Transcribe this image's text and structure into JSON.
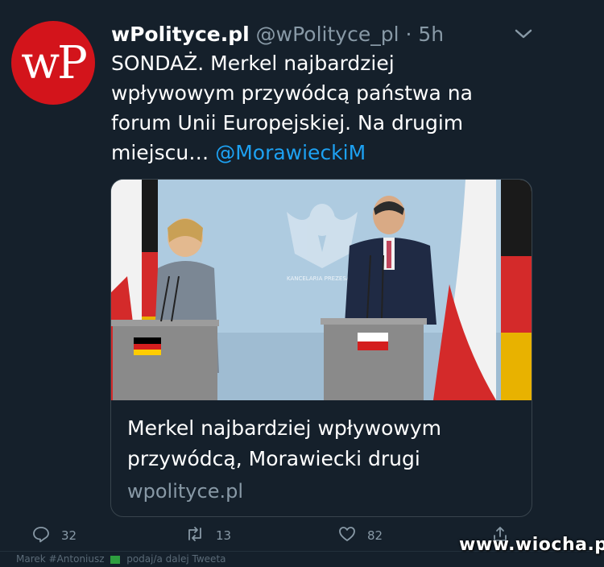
{
  "tweet": {
    "avatar_text": "wP",
    "display_name": "wPolityce.pl",
    "handle": "@wPolityce_pl",
    "separator": "·",
    "time": "5h",
    "text_line1": "SONDAŻ. Merkel najbardziej",
    "text_line2": "wpływowym przywódcą państwa na",
    "text_line3": "forum Unii Europejskiej. Na drugim",
    "text_line4_prefix": "miejscu…",
    "mention": "@MorawieckiM"
  },
  "card": {
    "title_line1": "Merkel najbardziej wpływowym",
    "title_line2": "przywódcą, Morawiecki drugi",
    "domain": "wpolityce.pl",
    "image_backdrop_text": "KANCELARIA PREZESA RADY MINISTRÓW"
  },
  "actions": {
    "reply_count": "32",
    "retweet_count": "13",
    "like_count": "82"
  },
  "footer_strip": {
    "text_left": "Marek #Antoniusz",
    "text_right": "podaj/a dalej Tweeta"
  },
  "watermark": "www.wiocha.pl",
  "colors": {
    "background": "#15202b",
    "mention": "#1da1f2",
    "muted": "#8899a6",
    "brand_red": "#d3141b"
  },
  "icons": [
    "chevron-down-icon",
    "reply-icon",
    "retweet-icon",
    "like-icon",
    "share-icon"
  ]
}
